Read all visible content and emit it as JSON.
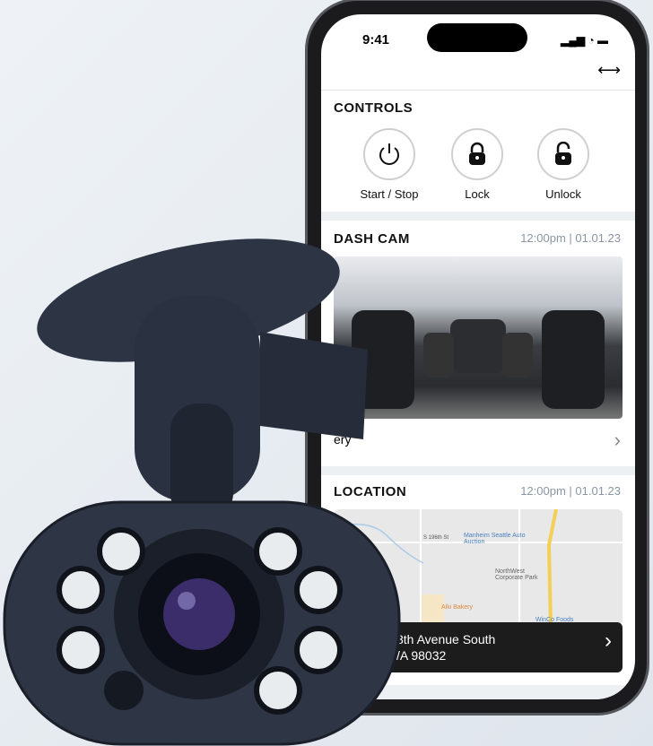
{
  "status_bar": {
    "time": "9:41"
  },
  "toolbar": {
    "swap_icon": "double-arrow-icon"
  },
  "controls": {
    "title": "CONTROLS",
    "buttons": [
      {
        "label": "Start / Stop",
        "icon": "power-icon"
      },
      {
        "label": "Lock",
        "icon": "lock-closed-icon"
      },
      {
        "label": "Unlock",
        "icon": "lock-open-icon"
      }
    ]
  },
  "dash_cam": {
    "title": "DASH CAM",
    "timestamp": "12:00pm | 01.01.23",
    "gallery_label": "ery"
  },
  "location": {
    "title": "LOCATION",
    "timestamp": "12:00pm | 01.01.23",
    "map_labels": [
      "Manheim Seattle Auto Auction",
      "NorthWest Corporate Park",
      "Alki Bakery",
      "WinCo Foods",
      "S 196th St"
    ],
    "address_line1": "8th Avenue South",
    "address_line2": "/A 98032"
  },
  "colors": {
    "accent_dark": "#1c1c1c",
    "timestamp_gray": "#8a96a3",
    "road_yellow": "#f3cf55"
  }
}
